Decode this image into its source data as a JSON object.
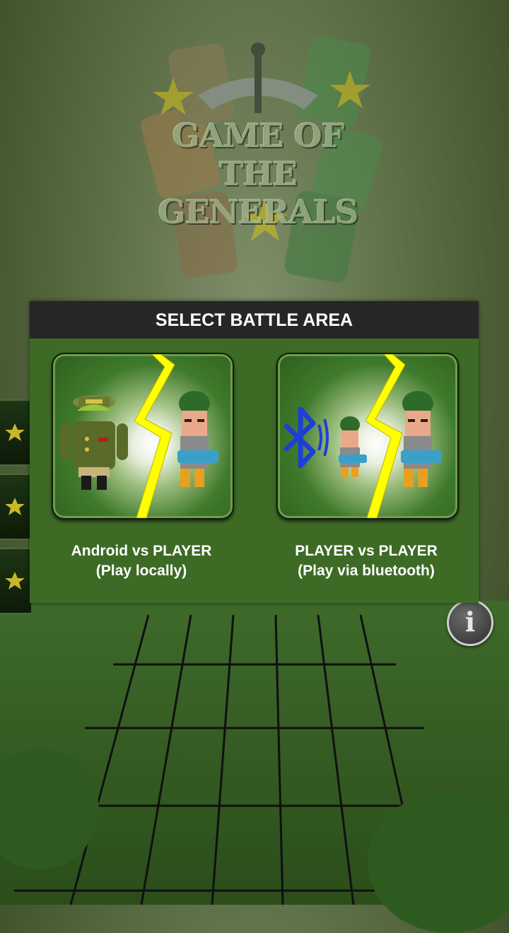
{
  "logo": {
    "title_line1": "GAME OF",
    "title_line2": "THE GENERALS"
  },
  "dialog": {
    "title": "SELECT BATTLE AREA",
    "options": [
      {
        "line1": "Android vs PLAYER",
        "line2": "(Play locally)"
      },
      {
        "line1": "PLAYER vs PLAYER",
        "line2": "(Play via bluetooth)"
      }
    ]
  },
  "info_button": {
    "glyph": "i"
  },
  "colors": {
    "dialog_bg": "#3d6b26",
    "header_bg": "#262626",
    "lightning": "#ffff00",
    "bluetooth": "#1e3fd6"
  }
}
